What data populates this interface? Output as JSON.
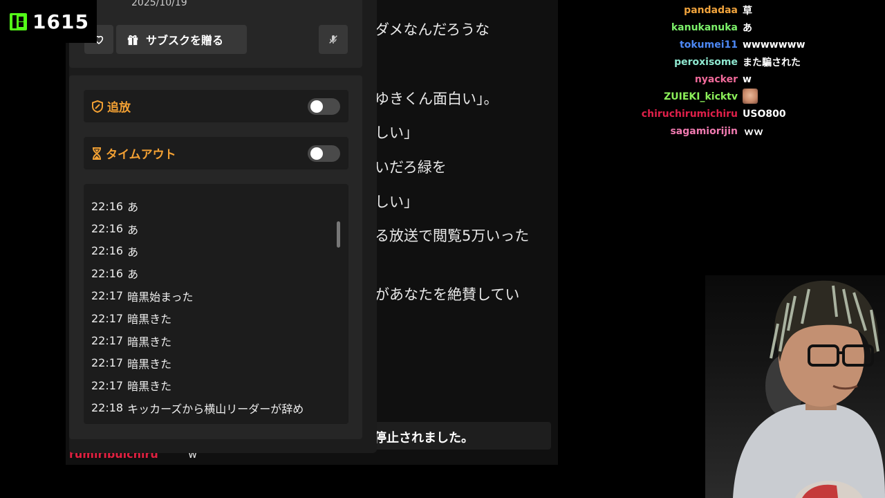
{
  "stream": {
    "viewer_count": "1615"
  },
  "background_chat": {
    "messages": [
      "ダメなんだろうな",
      "ゆきくん面白い」。",
      "しい」",
      "いだろ緑を",
      "しい」",
      "る放送で閲覧5万いった",
      "があなたを絶賛してい"
    ],
    "banner": "停止されました。",
    "bottom_user": "rumiribuichiru",
    "bottom_msg": "w"
  },
  "panel": {
    "date": "2025/10/19",
    "subscribe_gift_label": "サブスクを贈る",
    "ban": {
      "label": "追放",
      "enabled": false
    },
    "timeout": {
      "label": "タイムアウト",
      "enabled": false
    },
    "history": [
      {
        "time": "22:16",
        "text": "あ"
      },
      {
        "time": "22:16",
        "text": "あ"
      },
      {
        "time": "22:16",
        "text": "あ"
      },
      {
        "time": "22:16",
        "text": "あ"
      },
      {
        "time": "22:17",
        "text": "暗黒始まった"
      },
      {
        "time": "22:17",
        "text": "暗黒きた"
      },
      {
        "time": "22:17",
        "text": "暗黒きた"
      },
      {
        "time": "22:17",
        "text": "暗黒きた"
      },
      {
        "time": "22:17",
        "text": "暗黒きた"
      },
      {
        "time": "22:18",
        "text": "キッカーズから横山リーダーが辞め"
      }
    ]
  },
  "overlay_chat": [
    {
      "user": "pandadaa",
      "msg": "草",
      "color": "#f0a33c"
    },
    {
      "user": "kanukanuka",
      "msg": "あ",
      "color": "#7cf06a"
    },
    {
      "user": "tokumei11",
      "msg": "wwwwwww",
      "color": "#4d88f5"
    },
    {
      "user": "peroxisome",
      "msg": "また騙された",
      "color": "#8fe8d0"
    },
    {
      "user": "nyacker",
      "msg": "w",
      "color": "#f06a9a"
    },
    {
      "user": "ZUIEKI_kicktv",
      "msg": "",
      "color": "#8cf05a"
    },
    {
      "user": "chiruchirumichiru",
      "msg": "USO800",
      "color": "#e0204a"
    },
    {
      "user": "sagamiorijin",
      "msg": "ｗｗ",
      "color": "#f07ab0"
    }
  ],
  "colors": {
    "kick_green": "#53fc18",
    "moderation_orange": "#f2a033"
  }
}
